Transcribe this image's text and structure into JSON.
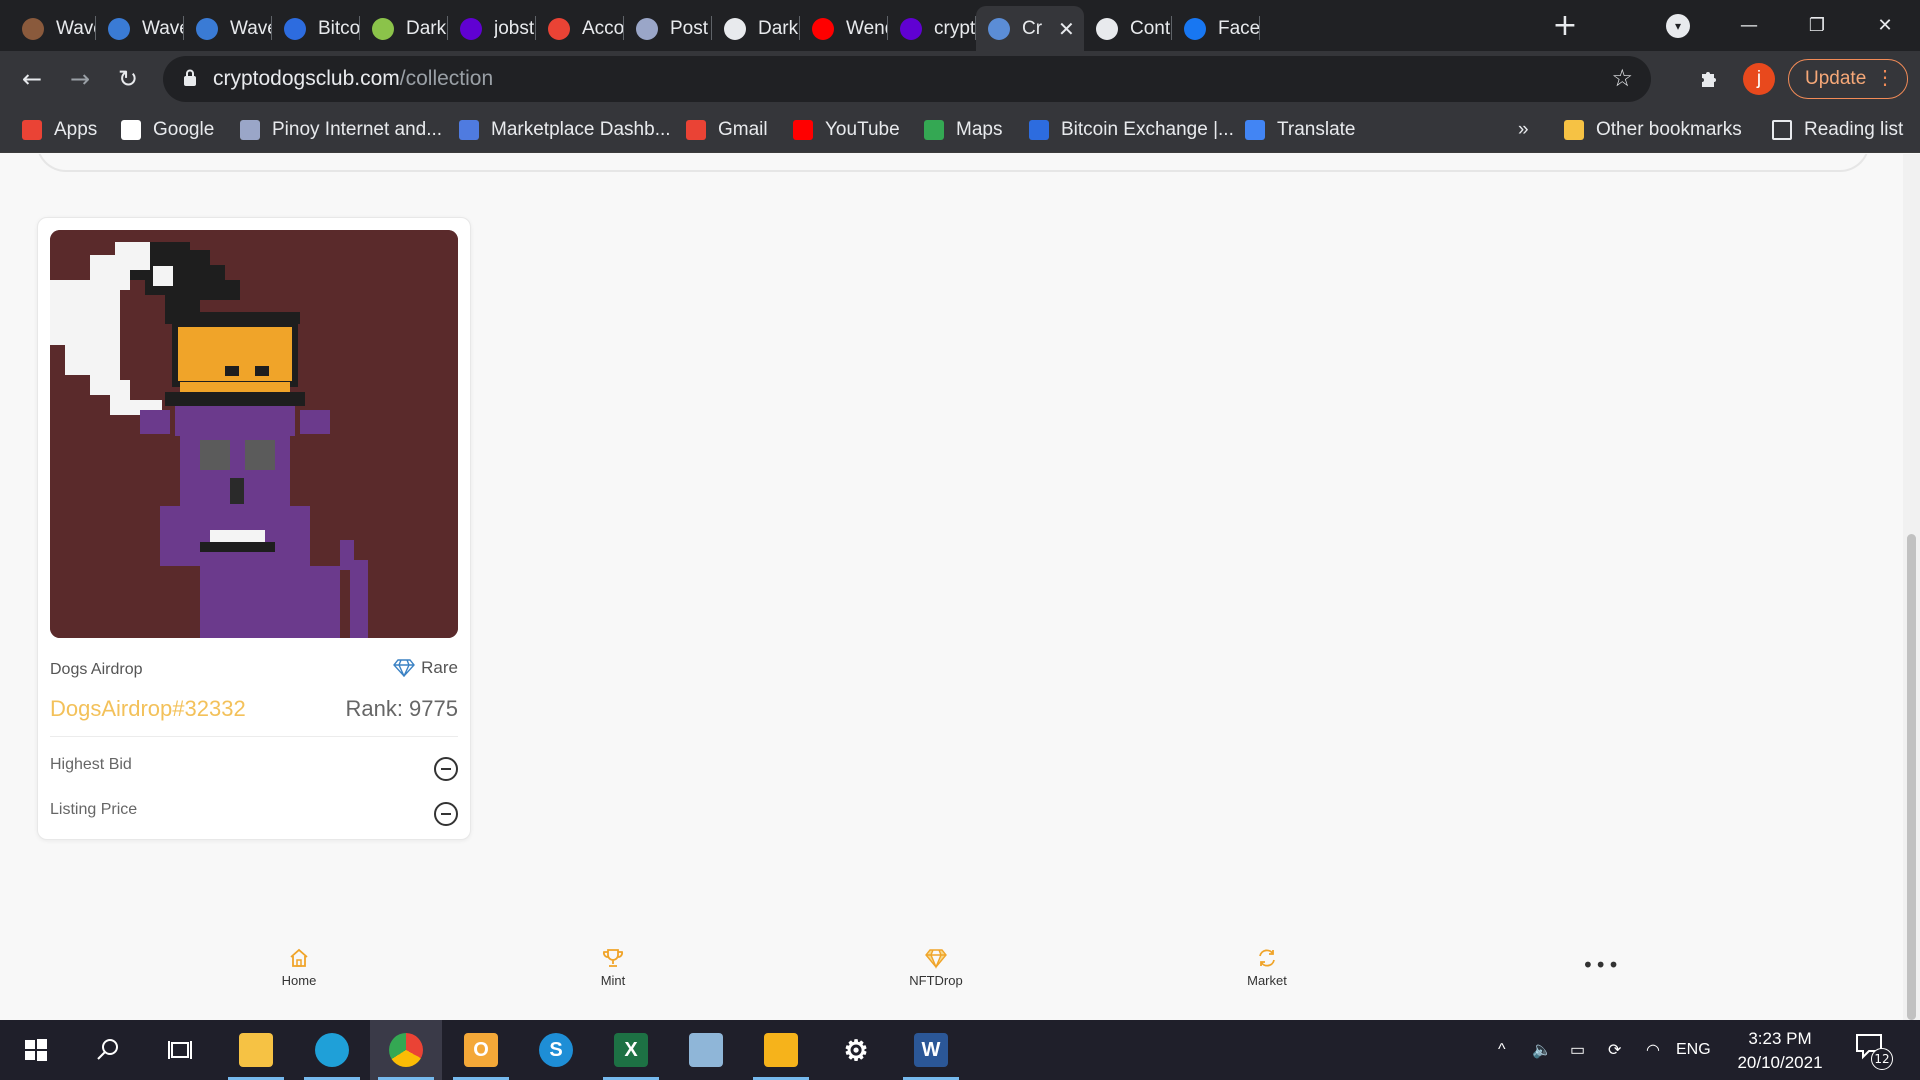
{
  "browser": {
    "tabs": [
      {
        "label": "Waves",
        "icon": "waves-favicon-icon",
        "color": "#8a5a3c"
      },
      {
        "label": "Waves",
        "icon": "waves-globe-icon",
        "color": "#3a7bd5"
      },
      {
        "label": "Waves",
        "icon": "waves-globe-icon",
        "color": "#3a7bd5"
      },
      {
        "label": "Bitcoin",
        "icon": "bitcoin-exchange-icon",
        "color": "#2d6cdf"
      },
      {
        "label": "Dark I",
        "icon": "dark-green-icon",
        "color": "#8bc34a"
      },
      {
        "label": "jobstr",
        "icon": "yahoo-icon",
        "color": "#6001d2"
      },
      {
        "label": "Accou",
        "icon": "gmail-icon",
        "color": "#ea4335"
      },
      {
        "label": "Post t",
        "icon": "shield-icon",
        "color": "#9aa6c8"
      },
      {
        "label": "DarkB",
        "icon": "darkb-chart-icon",
        "color": "#e8eaed"
      },
      {
        "label": "Wend",
        "icon": "youtube-icon",
        "color": "#ff0000"
      },
      {
        "label": "crypto",
        "icon": "yahoo-icon",
        "color": "#6001d2"
      },
      {
        "label": "Cr",
        "icon": "cryptodogs-favicon-icon",
        "color": "#5b8dd6",
        "active": true
      },
      {
        "label": "Contr",
        "icon": "contr-chart-icon",
        "color": "#e8eaed"
      },
      {
        "label": "Faceb",
        "icon": "facebook-icon",
        "color": "#1877f2"
      }
    ],
    "url": {
      "domain": "cryptodogsclub.com",
      "path": "/collection"
    },
    "profile_initial": "j",
    "update_label": "Update",
    "bookmarks": [
      {
        "label": "Apps",
        "icon": "apps-grid-icon",
        "color": "#ea4335"
      },
      {
        "label": "Google",
        "icon": "google-icon",
        "color": "#ffffff"
      },
      {
        "label": "Pinoy Internet and...",
        "icon": "shield-icon",
        "color": "#9aa6c8"
      },
      {
        "label": "Marketplace Dashb...",
        "icon": "marketplace-icon",
        "color": "#4f7be0"
      },
      {
        "label": "Gmail",
        "icon": "gmail-icon",
        "color": "#ea4335"
      },
      {
        "label": "YouTube",
        "icon": "youtube-icon",
        "color": "#ff0000"
      },
      {
        "label": "Maps",
        "icon": "maps-pin-icon",
        "color": "#34a853"
      },
      {
        "label": "Bitcoin Exchange |...",
        "icon": "bitcoin-exchange-icon",
        "color": "#2d6cdf"
      },
      {
        "label": "Translate",
        "icon": "translate-icon",
        "color": "#4285f4"
      }
    ],
    "bookmarks_overflow": "»",
    "other_bookmarks": "Other bookmarks",
    "reading_list": "Reading list"
  },
  "nft_card": {
    "collection": "Dogs Airdrop",
    "rarity": "Rare",
    "name": "DogsAirdrop#32332",
    "rank": "Rank: 9775",
    "highest_bid_label": "Highest Bid",
    "listing_price_label": "Listing Price",
    "name_color": "#f3c15a"
  },
  "bottom_nav": [
    {
      "label": "Home",
      "icon": "home-icon"
    },
    {
      "label": "Mint",
      "icon": "trophy-icon"
    },
    {
      "label": "NFTDrop",
      "icon": "diamond-icon"
    },
    {
      "label": "Market",
      "icon": "refresh-icon"
    }
  ],
  "bottom_nav_more": "•••",
  "taskbar": {
    "apps": [
      "file-explorer-icon",
      "edge-icon",
      "chrome-icon",
      "outlook-icon",
      "skype-icon",
      "excel-icon",
      "notepad-icon",
      "sticky-notes-icon",
      "settings-gear-icon",
      "word-icon"
    ],
    "language": "ENG",
    "time": "3:23 PM",
    "date": "20/10/2021",
    "notifications": "12"
  },
  "colors": {
    "accent_gold": "#f3c15a",
    "chrome_dark": "#202124",
    "chrome_toolbar": "#35363a",
    "update_orange": "#f28b57"
  }
}
